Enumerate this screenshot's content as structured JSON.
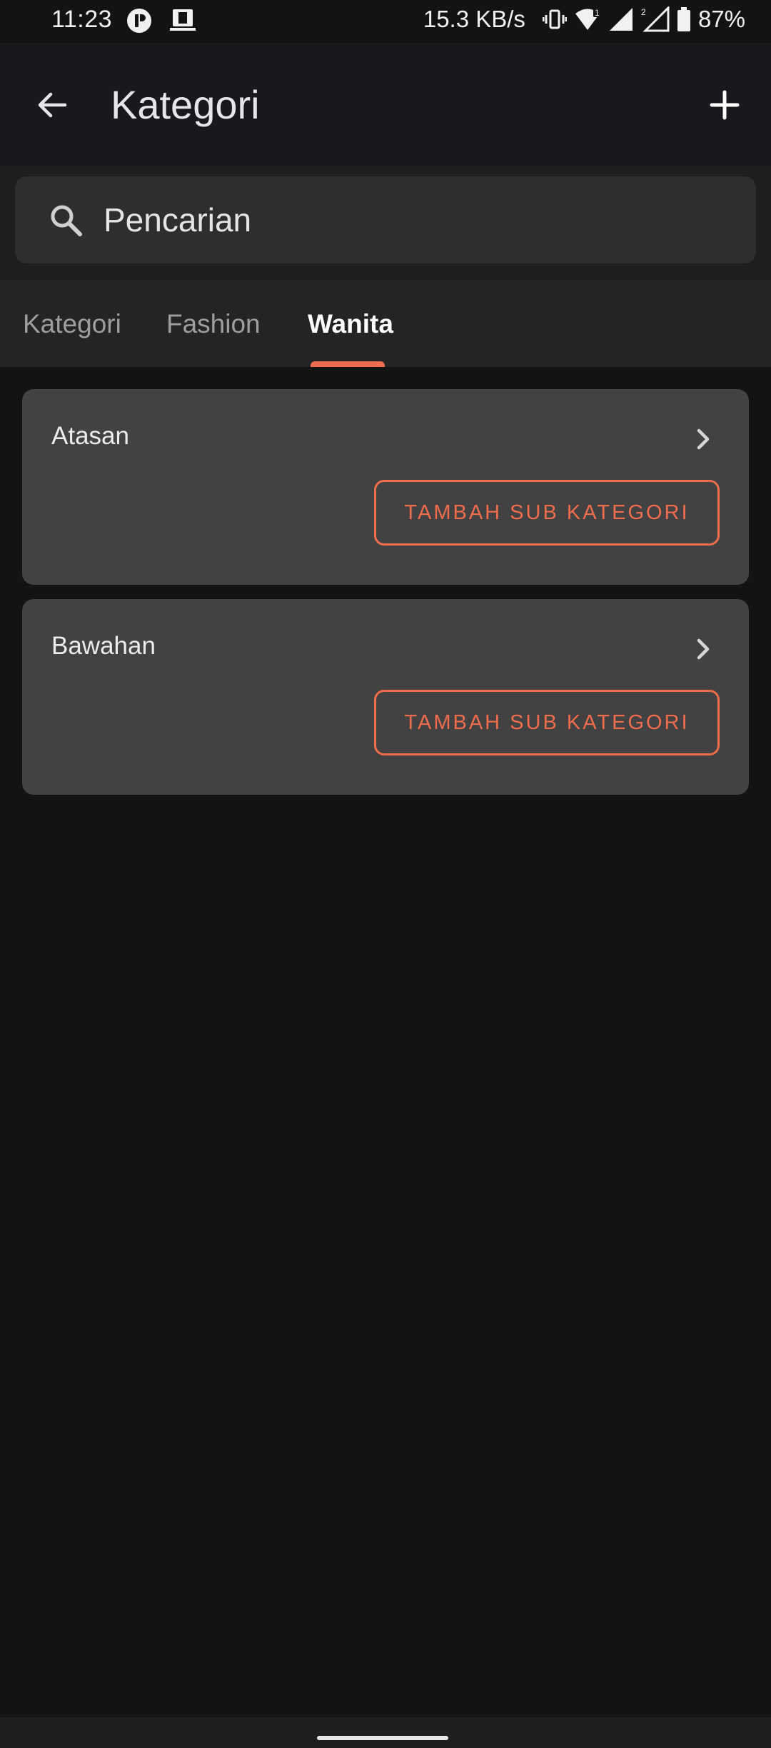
{
  "status_bar": {
    "time": "11:23",
    "net_speed": "15.3 KB/s",
    "battery": "87%",
    "left_icons": [
      "app-notification-icon",
      "media-icon"
    ],
    "right_icons": [
      "vibrate-icon",
      "wifi-icon",
      "signal-sim1-icon",
      "signal-sim2-icon",
      "battery-icon"
    ]
  },
  "app_bar": {
    "title": "Kategori",
    "back_icon": "arrow-left-icon",
    "add_icon": "plus-icon"
  },
  "search": {
    "placeholder": "Pencarian",
    "value": ""
  },
  "tabs": [
    {
      "label": "Kategori",
      "active": false
    },
    {
      "label": "Fashion",
      "active": false
    },
    {
      "label": "Wanita",
      "active": true
    }
  ],
  "categories": [
    {
      "name": "Atasan",
      "button_label": "TAMBAH SUB KATEGORI"
    },
    {
      "name": "Bawahan",
      "button_label": "TAMBAH SUB KATEGORI"
    }
  ],
  "colors": {
    "accent": "#ef6c4c",
    "background": "#131314",
    "card": "#424242",
    "app_bar": "#1a181d"
  }
}
